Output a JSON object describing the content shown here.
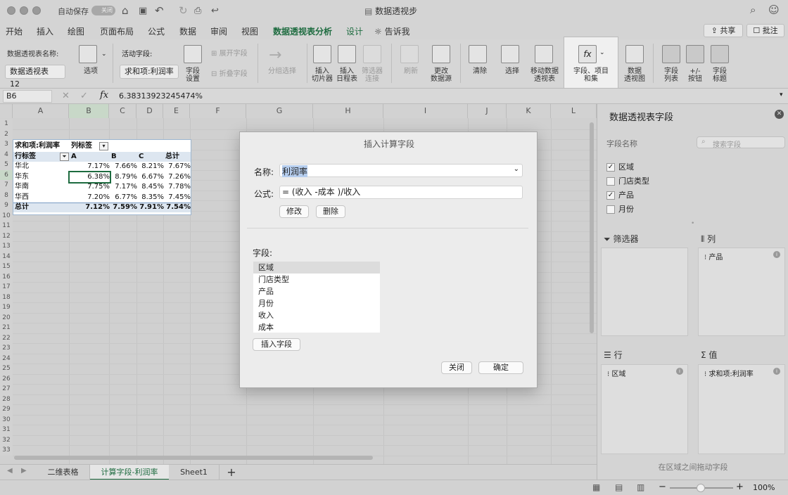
{
  "titlebar": {
    "autosave_label": "自动保存",
    "autosave_state": "关闭",
    "doc_title": "数据透视步"
  },
  "menu": {
    "tabs": [
      "开始",
      "插入",
      "绘图",
      "页面布局",
      "公式",
      "数据",
      "审阅",
      "视图",
      "数据透视表分析",
      "设计"
    ],
    "tell_me": "告诉我",
    "share": "共享",
    "comments": "批注"
  },
  "ribbon": {
    "pivot_name_label": "数据透视表名称:",
    "pivot_name_value": "数据透视表 12",
    "options": "选项",
    "active_field_label": "活动字段:",
    "active_field_value": "求和项:利润率",
    "field_settings": "字段\n设置",
    "expand_field": "展开字段",
    "collapse_field": "折叠字段",
    "group_select": "分组选择",
    "insert_slicer": "插入\n切片器",
    "insert_timeline": "插入\n日程表",
    "filter_connections": "筛选器\n连接",
    "refresh": "刷新",
    "change_source": "更改\n数据源",
    "clear": "清除",
    "select": "选择",
    "move_pivot": "移动数据\n透视表",
    "fields_items_sets": "字段、项目\n和集",
    "pivot_chart": "数据\n透视图",
    "field_list": "字段\n列表",
    "buttons": "+/-\n按钮",
    "field_headers": "字段\n标题"
  },
  "formula_bar": {
    "cell_ref": "B6",
    "fx": "fx",
    "value": "6.38313923245474%"
  },
  "sheet": {
    "columns": [
      "A",
      "B",
      "C",
      "D",
      "E",
      "F",
      "G",
      "H",
      "I",
      "J",
      "K",
      "L"
    ],
    "rows": [
      "1",
      "2",
      "3",
      "4",
      "5",
      "6",
      "7",
      "8",
      "9",
      "10",
      "11",
      "12",
      "13",
      "14",
      "15",
      "16",
      "17",
      "18",
      "19",
      "20",
      "21",
      "22",
      "23",
      "24",
      "25",
      "26",
      "27",
      "28",
      "29",
      "30",
      "31",
      "32",
      "33"
    ],
    "pivot": {
      "header_sum": "求和项:利润率",
      "header_col": "列标签",
      "row_label": "行标签",
      "col_keys": [
        "A",
        "B",
        "C",
        "总计"
      ],
      "rows": [
        {
          "name": "华北",
          "values": [
            "7.17%",
            "7.66%",
            "8.21%",
            "7.67%"
          ]
        },
        {
          "name": "华东",
          "values": [
            "6.38%",
            "8.79%",
            "6.67%",
            "7.26%"
          ]
        },
        {
          "name": "华南",
          "values": [
            "7.75%",
            "7.17%",
            "8.45%",
            "7.78%"
          ]
        },
        {
          "name": "华西",
          "values": [
            "7.20%",
            "6.77%",
            "8.35%",
            "7.45%"
          ]
        }
      ],
      "total": {
        "name": "总计",
        "values": [
          "7.12%",
          "7.59%",
          "7.91%",
          "7.54%"
        ]
      }
    }
  },
  "dialog": {
    "title": "插入计算字段",
    "name_label": "名称:",
    "name_value": "利润率",
    "formula_label": "公式:",
    "formula_value": "= (收入 -成本 )/收入",
    "modify": "修改",
    "delete": "删除",
    "fields_label": "字段:",
    "fields": [
      "区域",
      "门店类型",
      "产品",
      "月份",
      "收入",
      "成本"
    ],
    "insert_field": "插入字段",
    "close": "关闭",
    "ok": "确定"
  },
  "panel": {
    "title": "数据透视表字段",
    "field_name_label": "字段名称",
    "search_placeholder": "搜索字段",
    "fields": [
      {
        "name": "区域",
        "checked": true
      },
      {
        "name": "门店类型",
        "checked": false
      },
      {
        "name": "产品",
        "checked": true
      },
      {
        "name": "月份",
        "checked": false
      }
    ],
    "filters": "筛选器",
    "columns": "列",
    "columns_item": "产品",
    "rows": "行",
    "rows_item": "区域",
    "values": "值",
    "values_item": "求和项:利润率",
    "hint": "在区域之间拖动字段"
  },
  "sheet_tabs": [
    "二维表格",
    "计算字段-利润率",
    "Sheet1"
  ],
  "status": {
    "zoom": "100%"
  }
}
